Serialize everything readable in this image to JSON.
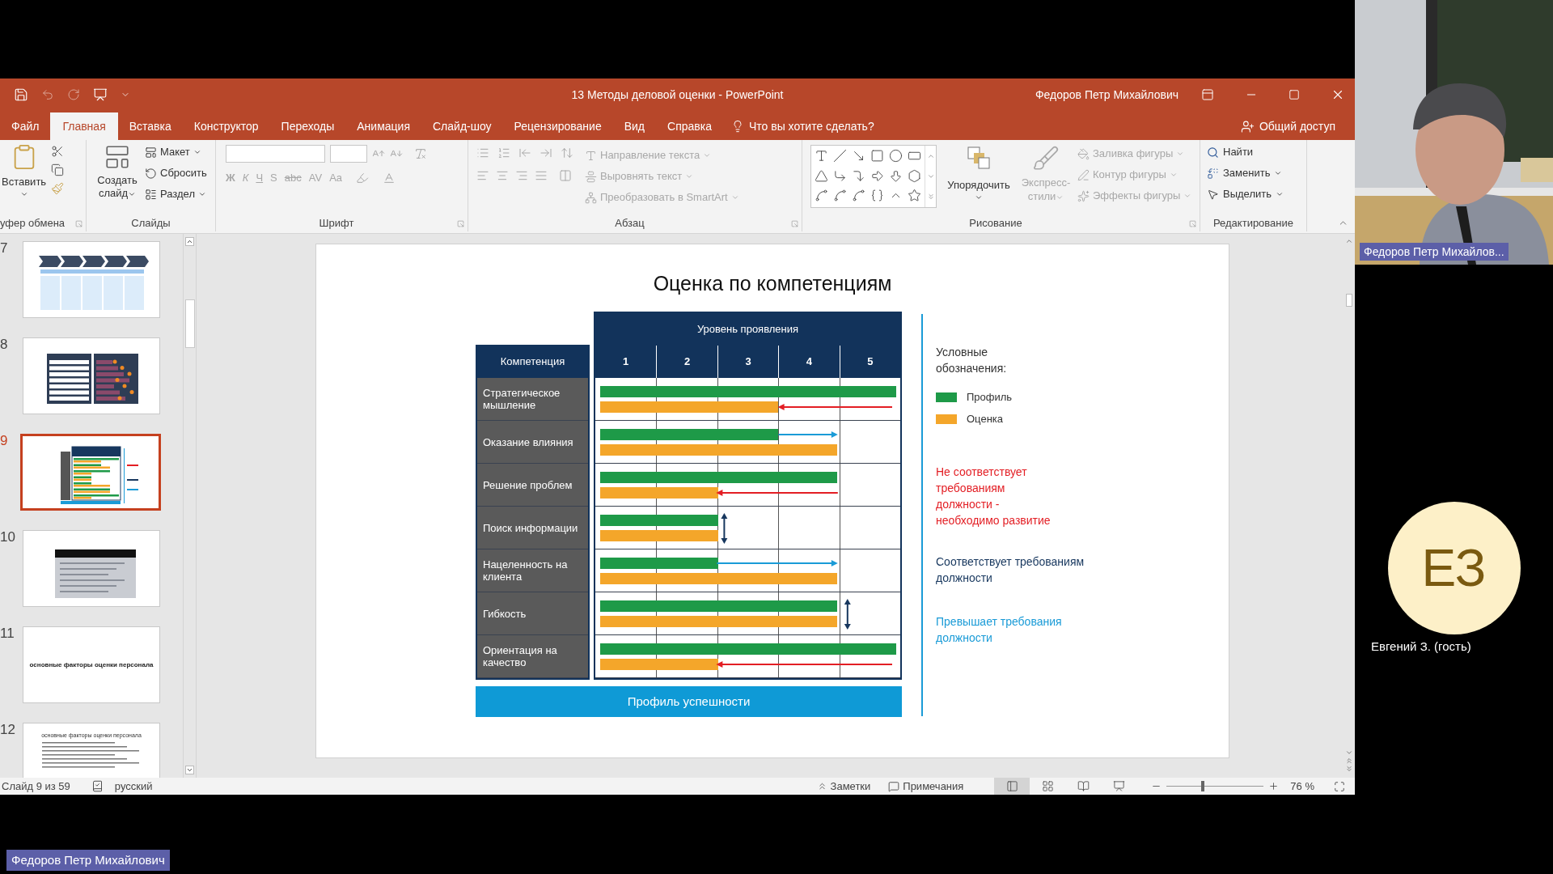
{
  "window": {
    "title": "13 Методы деловой оценки - PowerPoint",
    "user": "Федоров Петр Михайлович"
  },
  "tabs": [
    {
      "label": "Файл",
      "selected": false
    },
    {
      "label": "Главная",
      "selected": true
    },
    {
      "label": "Вставка",
      "selected": false
    },
    {
      "label": "Конструктор",
      "selected": false
    },
    {
      "label": "Переходы",
      "selected": false
    },
    {
      "label": "Анимация",
      "selected": false
    },
    {
      "label": "Слайд-шоу",
      "selected": false
    },
    {
      "label": "Рецензирование",
      "selected": false
    },
    {
      "label": "Вид",
      "selected": false
    },
    {
      "label": "Справка",
      "selected": false
    }
  ],
  "tell_me": "Что вы хотите сделать?",
  "share": "Общий доступ",
  "ribbon": {
    "groups": [
      {
        "kind": "clipboard",
        "label": "уфер обмена",
        "paste": "Вставить"
      },
      {
        "kind": "slides",
        "label": "Слайды",
        "new_slide": "Создать слайд",
        "items": [
          {
            "label": "Макет",
            "menu": true
          },
          {
            "label": "Сбросить",
            "menu": false
          },
          {
            "label": "Раздел",
            "menu": true
          }
        ]
      },
      {
        "kind": "font",
        "label": "Шрифт",
        "disabled": true,
        "format_buttons": [
          "Ж",
          "К",
          "Ч",
          "S",
          "abc",
          "AV",
          "Aa"
        ]
      },
      {
        "kind": "paragraph",
        "label": "Абзац",
        "disabled": true,
        "items": [
          "Направление текста",
          "Выровнять текст",
          "Преобразовать в SmartArt"
        ]
      },
      {
        "kind": "drawing",
        "label": "Рисование",
        "disabled": true,
        "arrange": "Упорядочить",
        "styles": "Экспресс-стили",
        "items": [
          "Заливка фигуры",
          "Контур фигуры",
          "Эффекты фигуры"
        ]
      },
      {
        "kind": "editing",
        "label": "Редактирование",
        "items": [
          {
            "label": "Найти",
            "menu": false
          },
          {
            "label": "Заменить",
            "menu": true
          },
          {
            "label": "Выделить",
            "menu": true
          }
        ]
      }
    ]
  },
  "thumbnails": [
    {
      "number": "7",
      "kind": "process",
      "selected": false
    },
    {
      "number": "8",
      "kind": "table",
      "selected": false
    },
    {
      "number": "9",
      "kind": "bars",
      "selected": true
    },
    {
      "number": "10",
      "kind": "text-box",
      "selected": false
    },
    {
      "number": "11",
      "kind": "title",
      "selected": false,
      "title": "основные факторы оценки персонала"
    },
    {
      "number": "12",
      "kind": "list",
      "selected": false,
      "title": "основные факторы оценки персонала"
    }
  ],
  "slide": {
    "title": "Оценка по компетенциям",
    "level_header": "Уровень проявления",
    "competency_header": "Компетенция",
    "levels": [
      "1",
      "2",
      "3",
      "4",
      "5"
    ],
    "rows": [
      {
        "name": "Стратегическое мышление",
        "profile": {
          "level": 1
        },
        "rating": {
          "level": 0.6
        },
        "kind": "below"
      },
      {
        "name": "Оказание влияния",
        "profile": {
          "level": 0.6
        },
        "rating": {
          "level": 0.8
        },
        "kind": "above"
      },
      {
        "name": "Решение проблем",
        "profile": {
          "level": 0.8
        },
        "rating": {
          "level": 0.4
        },
        "kind": "below"
      },
      {
        "name": "Поиск информации",
        "profile": {
          "level": 0.4
        },
        "rating": {
          "level": 0.4
        },
        "kind": "match"
      },
      {
        "name": "Нацеленность на клиента",
        "profile": {
          "level": 0.4
        },
        "rating": {
          "level": 0.8
        },
        "kind": "above"
      },
      {
        "name": "Гибкость",
        "profile": {
          "level": 0.8
        },
        "rating": {
          "level": 0.8
        },
        "kind": "match"
      },
      {
        "name": "Ориентация на качество",
        "profile": {
          "level": 1
        },
        "rating": {
          "level": 0.4
        },
        "kind": "below"
      }
    ],
    "footer": "Профиль успешности",
    "legend": {
      "title": "Условные обозначения:",
      "items": [
        {
          "label": "Профиль",
          "color": "#1e9a48"
        },
        {
          "label": "Оценка",
          "color": "#f4a62a"
        }
      ],
      "notes": [
        {
          "kind": "below",
          "text": "Не соответствует требованиям должности - необходимо развитие",
          "color": "#e31e24"
        },
        {
          "kind": "match",
          "text": "Соответствует требованиям должности",
          "color": "#17375e"
        },
        {
          "kind": "above",
          "text": "Превышает требования должности",
          "color": "#1a9bd7"
        }
      ]
    }
  },
  "status_bar": {
    "slide_info": "Слайд 9 из 59",
    "language": "русский",
    "notes": "Заметки",
    "comments": "Примечания",
    "views": [
      {
        "kind": "normal",
        "selected": true
      },
      {
        "kind": "sorter",
        "selected": false
      },
      {
        "kind": "reading",
        "selected": false
      },
      {
        "kind": "slideshow",
        "selected": false
      }
    ],
    "zoom": {
      "level": 0.37,
      "value": "76 %"
    }
  },
  "presenter_video": {
    "kind": "picture",
    "name": "Федоров Петр Михайлов..."
  },
  "guest": {
    "initials": "ЕЗ",
    "name": "Евгений З. (гость)"
  },
  "presenter_badge": "Федоров Петр Михайлович"
}
